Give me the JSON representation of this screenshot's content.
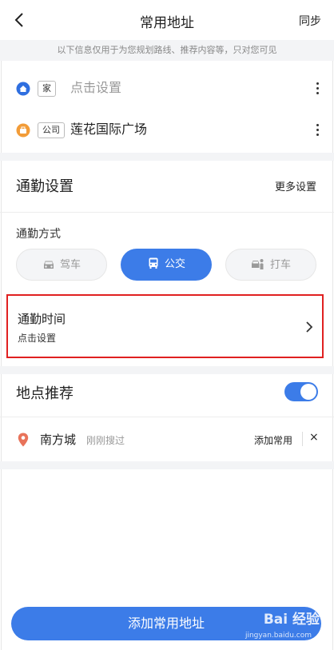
{
  "header": {
    "title": "常用地址",
    "sync_label": "同步"
  },
  "notice": "以下信息仅用于为您规划路线、推荐内容等，只对您可见",
  "addresses": [
    {
      "tag": "家",
      "text": "点击设置",
      "icon": "home-pin-icon",
      "color": "#2f6fe0",
      "text_color": "#999999"
    },
    {
      "tag": "公司",
      "text": "莲花国际广场",
      "icon": "work-pin-icon",
      "color": "#f29c38",
      "text_color": "#222222"
    }
  ],
  "commute_settings": {
    "title": "通勤设置",
    "more_label": "更多设置",
    "mode_label": "通勤方式",
    "modes": [
      {
        "label": "驾车",
        "icon": "car-icon",
        "selected": false
      },
      {
        "label": "公交",
        "icon": "bus-icon",
        "selected": true
      },
      {
        "label": "打车",
        "icon": "taxi-icon",
        "selected": false
      }
    ],
    "time_title": "通勤时间",
    "time_value": "点击设置"
  },
  "recommend": {
    "title": "地点推荐",
    "enabled": true,
    "items": [
      {
        "name": "南方城",
        "note": "刚刚搜过",
        "action": "添加常用",
        "close": "×"
      }
    ]
  },
  "primary_button": "添加常用地址",
  "watermark": {
    "brand": "Bai 经验",
    "url": "jingyan.baidu.com"
  },
  "colors": {
    "accent": "#3c7ce8",
    "highlight_border": "#e02020",
    "home": "#2f6fe0",
    "work": "#f29c38",
    "recommend_pin": "#e8735a"
  }
}
